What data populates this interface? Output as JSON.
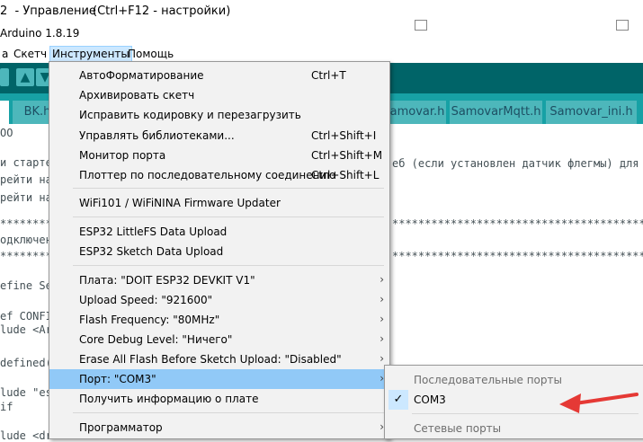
{
  "window": {
    "title_prefix": "2  - Управление",
    "title_hint": "(Ctrl+F12 - настройки)",
    "app_name": "Arduino 1.8.19"
  },
  "menubar": {
    "items": [
      "а",
      "Скетч",
      "Инструменты",
      "Помощь"
    ],
    "active": "Инструменты"
  },
  "tabs": [
    {
      "label": "BK.h",
      "selected": false
    },
    {
      "label": "amovar.h",
      "selected": false
    },
    {
      "label": "SamovarMqtt.h",
      "selected": false
    },
    {
      "label": "Samovar_ini.h",
      "selected": false
    },
    {
      "label": "",
      "selected": true
    }
  ],
  "editor": {
    "lines": [
      "OO",
      "и стартер",
      "рейти на",
      "рейти на",
      "************",
      "одключен",
      "************",
      "efine Se",
      "ef CONFI",
      "lude <Ar",
      "defined(",
      "lude \"es",
      "if",
      "lude <dr"
    ],
    "right_fragments": [
      "еб (если установлен датчик флегмы) для см",
      "******************************************",
      "******************************************"
    ]
  },
  "tools_menu": {
    "items": [
      {
        "label": "АвтоФорматирование",
        "shortcut": "Ctrl+T",
        "submenu": false
      },
      {
        "label": "Архивировать скетч",
        "shortcut": "",
        "submenu": false
      },
      {
        "label": "Исправить кодировку и перезагрузить",
        "shortcut": "",
        "submenu": false
      },
      {
        "label": "Управлять библиотеками...",
        "shortcut": "Ctrl+Shift+I",
        "submenu": false
      },
      {
        "label": "Монитор порта",
        "shortcut": "Ctrl+Shift+M",
        "submenu": false
      },
      {
        "label": "Плоттер по последовательному соединению",
        "shortcut": "Ctrl+Shift+L",
        "submenu": false
      },
      {
        "label": "WiFi101 / WiFiNINA Firmware Updater",
        "shortcut": "",
        "submenu": false
      },
      {
        "label": "ESP32 LittleFS Data Upload",
        "shortcut": "",
        "submenu": false
      },
      {
        "label": "ESP32 Sketch Data Upload",
        "shortcut": "",
        "submenu": false
      },
      {
        "label": "Плата: \"DOIT ESP32 DEVKIT V1\"",
        "shortcut": "",
        "submenu": true
      },
      {
        "label": "Upload Speed: \"921600\"",
        "shortcut": "",
        "submenu": true
      },
      {
        "label": "Flash Frequency: \"80MHz\"",
        "shortcut": "",
        "submenu": true
      },
      {
        "label": "Core Debug Level: \"Ничего\"",
        "shortcut": "",
        "submenu": true
      },
      {
        "label": "Erase All Flash Before Sketch Upload: \"Disabled\"",
        "shortcut": "",
        "submenu": true
      },
      {
        "label": "Порт: \"COM3\"",
        "shortcut": "",
        "submenu": true,
        "highlighted": true
      },
      {
        "label": "Получить информацию о плате",
        "shortcut": "",
        "submenu": false
      },
      {
        "label": "Программатор",
        "shortcut": "",
        "submenu": true
      }
    ],
    "arrow_glyph": "›"
  },
  "port_submenu": {
    "serial_header": "Последовательные порты",
    "selected_port": "COM3",
    "check_glyph": "✓",
    "network_header": "Сетевые порты"
  },
  "colors": {
    "toolbar": "#006468",
    "tabbar": "#17a1a5",
    "highlight": "#91c9f7",
    "annotation_arrow": "#e53935"
  }
}
